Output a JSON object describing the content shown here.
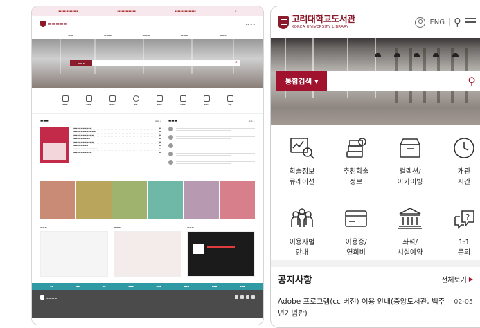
{
  "mobile": {
    "logo": {
      "ko": "고려대학교도서관",
      "en": "KOREA UNIVERSITY LIBRARY"
    },
    "header": {
      "lang": "ENG"
    },
    "search": {
      "scope": "통합검색",
      "placeholder": ""
    },
    "services": [
      {
        "label": "학술정보\n큐레이션",
        "icon": "research-curation-icon"
      },
      {
        "label": "추천학술\n정보",
        "icon": "recommended-research-icon"
      },
      {
        "label": "컬렉션/\n아카이빙",
        "icon": "collection-archive-icon"
      },
      {
        "label": "개관\n시간",
        "icon": "clock-icon"
      },
      {
        "label": "이용자별\n안내",
        "icon": "users-guide-icon"
      },
      {
        "label": "이용증/\n연회비",
        "icon": "card-icon"
      },
      {
        "label": "좌석/\n시설예약",
        "icon": "facility-icon"
      },
      {
        "label": "1:1\n문의",
        "icon": "inquiry-icon"
      }
    ],
    "notice": {
      "title": "공지사항",
      "more": "전체보기",
      "items": [
        {
          "title": "Adobe 프로그램(cc 버전) 이용 안내(중앙도서관, 백주년기념관)",
          "date": "02-05"
        }
      ]
    }
  },
  "colors": {
    "brand": "#8b1a2b",
    "search_accent": "#a1122e",
    "band": "#2f9aa4",
    "footer": "#4b4b4b"
  }
}
